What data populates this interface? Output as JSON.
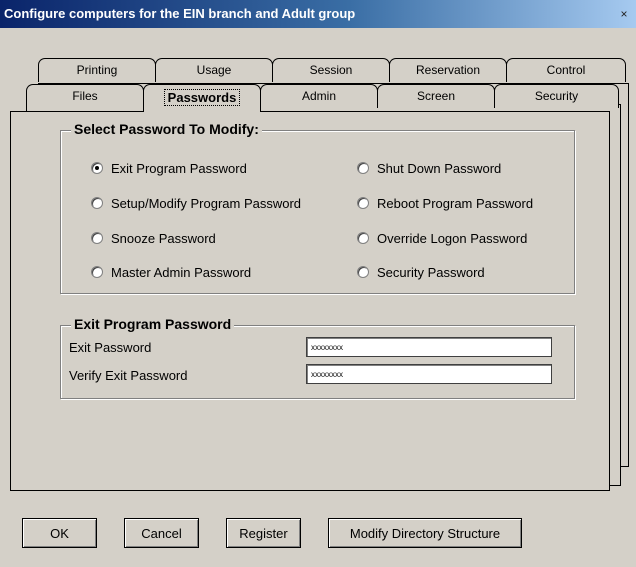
{
  "window": {
    "title": "Configure computers for the EIN branch and Adult group",
    "close": "×"
  },
  "tabs": {
    "row1": [
      "Printing",
      "Usage",
      "Session",
      "Reservation",
      "Control"
    ],
    "row2": [
      "Files",
      "Passwords",
      "Admin",
      "Screen",
      "Security"
    ],
    "active": "Passwords"
  },
  "select_group": {
    "legend": "Select Password To Modify:",
    "options": [
      {
        "label": "Exit Program Password",
        "checked": true
      },
      {
        "label": "Setup/Modify Program Password",
        "checked": false
      },
      {
        "label": "Snooze Password",
        "checked": false
      },
      {
        "label": "Master Admin Password",
        "checked": false
      },
      {
        "label": "Shut Down Password",
        "checked": false
      },
      {
        "label": "Reboot Program Password",
        "checked": false
      },
      {
        "label": "Override Logon Password",
        "checked": false
      },
      {
        "label": "Security Password",
        "checked": false
      }
    ]
  },
  "exit_group": {
    "legend": "Exit Program Password",
    "exit_label": "Exit Password",
    "exit_value": "xxxxxxxx",
    "verify_label": "Verify Exit Password",
    "verify_value": "xxxxxxxx"
  },
  "buttons": {
    "ok": "OK",
    "cancel": "Cancel",
    "register": "Register",
    "modify": "Modify Directory Structure"
  }
}
